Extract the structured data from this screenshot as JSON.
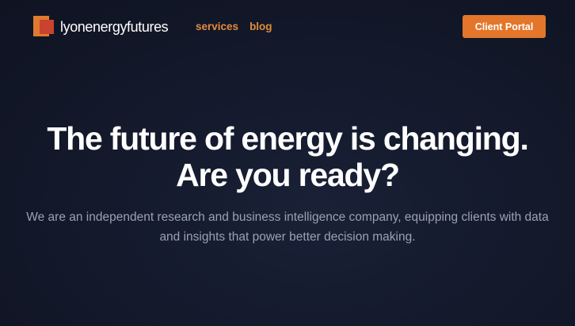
{
  "brand": {
    "name": "lyonenergyfutures",
    "colors": {
      "accent": "#e3762a",
      "logo_primary": "#e07a2e",
      "logo_secondary": "#c9432f",
      "background": "#141a2c"
    }
  },
  "nav": {
    "items": [
      {
        "label": "services"
      },
      {
        "label": "blog"
      }
    ]
  },
  "header": {
    "portal_label": "Client Portal"
  },
  "hero": {
    "headline_line1": "The future of energy is changing.",
    "headline_line2": "Are you ready?",
    "subtext": "We are an independent research and business intelligence company, equipping clients with data and insights that power better decision making."
  }
}
